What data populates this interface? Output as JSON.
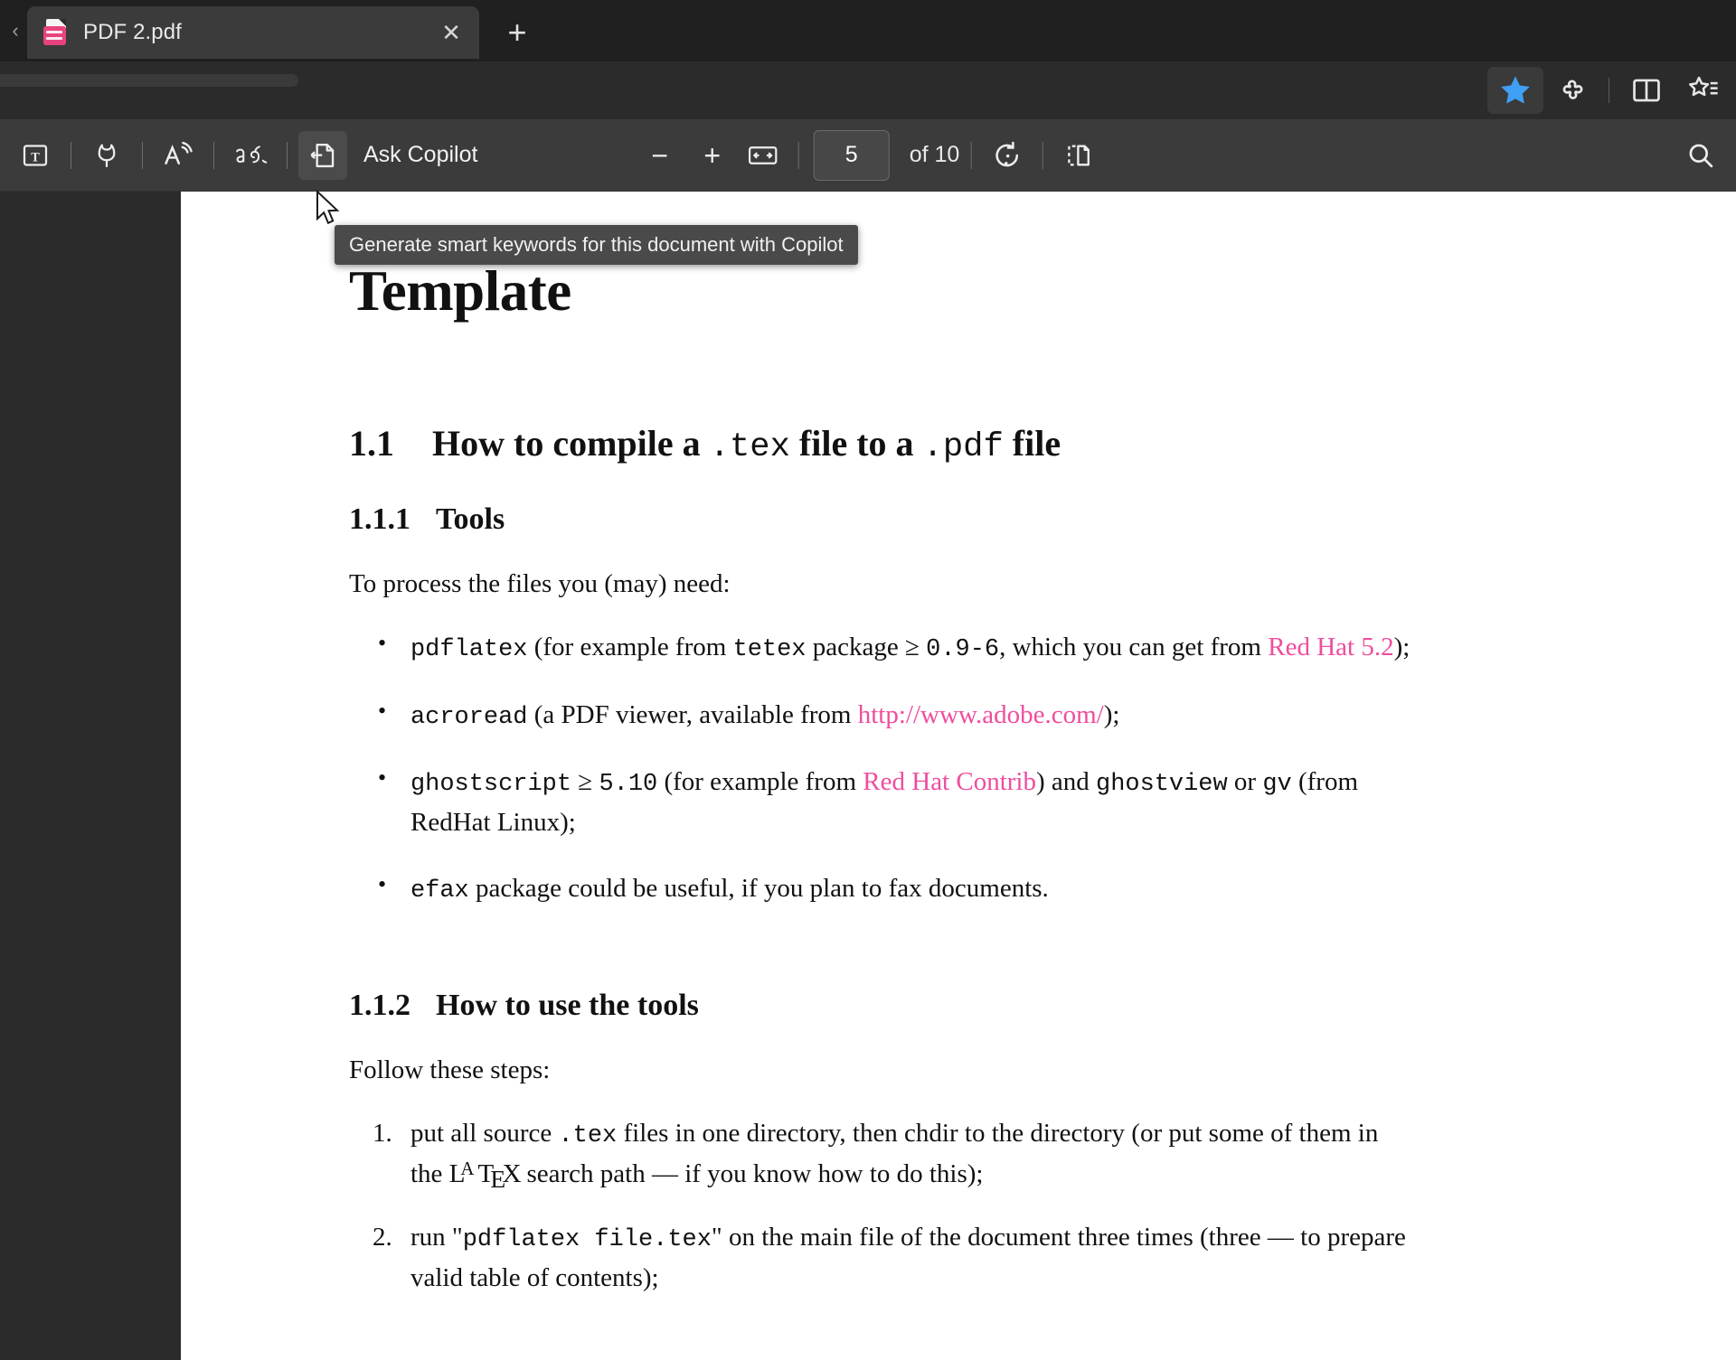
{
  "browser": {
    "tab": {
      "title": "PDF 2.pdf",
      "favicon": "pdf-file-icon",
      "close_label": "✕"
    },
    "new_tab_label": "+",
    "back_chevron": "‹",
    "actions": [
      {
        "name": "favorite-star-icon",
        "state": "filled",
        "color": "#3f9ff5"
      },
      {
        "name": "extensions-icon"
      },
      {
        "name": "split-screen-icon"
      },
      {
        "name": "collections-icon"
      }
    ]
  },
  "pdf_toolbar": {
    "tools": [
      {
        "name": "text-selection-icon",
        "label": "T"
      },
      {
        "name": "draw-ink-icon"
      },
      {
        "name": "read-aloud-icon"
      },
      {
        "name": "translate-icon"
      },
      {
        "name": "smart-keywords-icon",
        "active": true
      }
    ],
    "ask_copilot_label": "Ask Copilot",
    "zoom_out_label": "−",
    "zoom_in_label": "+",
    "fit_to_width_name": "fit-to-width-icon",
    "page_number": "5",
    "page_total_label": "of 10",
    "rotate_name": "rotate-page-icon",
    "page_layout_name": "page-view-icon",
    "search_name": "search-icon"
  },
  "tooltip": {
    "text": "Generate smart keywords for this document with Copilot"
  },
  "document": {
    "title": "Template",
    "section1": {
      "number": "1.1",
      "parts": [
        {
          "text": "How to compile a ",
          "style": "bold"
        },
        {
          "text": ".tex",
          "style": "mono"
        },
        {
          "text": " file to a ",
          "style": "bold"
        },
        {
          "text": ".pdf",
          "style": "mono"
        },
        {
          "text": " file",
          "style": "bold"
        }
      ]
    },
    "subsection_tools": {
      "number": "1.1.1",
      "title": "Tools"
    },
    "intro_tools": "To process the files you (may) need:",
    "bullets": [
      {
        "segments": [
          {
            "t": "pdflatex",
            "s": "mono"
          },
          {
            "t": " (for example from ",
            "s": "normal"
          },
          {
            "t": "tetex",
            "s": "mono"
          },
          {
            "t": " package ",
            "s": "normal"
          },
          {
            "t": "≥ ",
            "s": "normal"
          },
          {
            "t": "0.9-6",
            "s": "mono"
          },
          {
            "t": ", which you can get from ",
            "s": "normal"
          },
          {
            "t": "Red Hat 5.2",
            "s": "link"
          },
          {
            "t": ");",
            "s": "normal"
          }
        ]
      },
      {
        "segments": [
          {
            "t": "acroread",
            "s": "mono"
          },
          {
            "t": " (a PDF viewer, available from ",
            "s": "normal"
          },
          {
            "t": "http://www.adobe.com/",
            "s": "link"
          },
          {
            "t": ");",
            "s": "normal"
          }
        ]
      },
      {
        "segments": [
          {
            "t": "ghostscript",
            "s": "mono"
          },
          {
            "t": " ≥ ",
            "s": "normal"
          },
          {
            "t": "5.10",
            "s": "mono"
          },
          {
            "t": " (for example from ",
            "s": "normal"
          },
          {
            "t": "Red Hat Contrib",
            "s": "link"
          },
          {
            "t": ") and ",
            "s": "normal"
          },
          {
            "t": "ghostview",
            "s": "mono"
          },
          {
            "t": " or ",
            "s": "normal"
          },
          {
            "t": "gv",
            "s": "mono"
          },
          {
            "t": " (from RedHat Linux);",
            "s": "normal"
          }
        ]
      },
      {
        "segments": [
          {
            "t": "efax",
            "s": "mono"
          },
          {
            "t": " package could be useful, if you plan to fax documents.",
            "s": "normal"
          }
        ]
      }
    ],
    "subsection_howto": {
      "number": "1.1.2",
      "title": "How to use the tools"
    },
    "intro_howto": "Follow these steps:",
    "steps": [
      {
        "segments": [
          {
            "t": "put all source ",
            "s": "normal"
          },
          {
            "t": ".tex",
            "s": "mono"
          },
          {
            "t": " files in one directory, then chdir to the directory (or put some of them in the ",
            "s": "normal"
          },
          {
            "t": "LaTeX",
            "s": "latex"
          },
          {
            "t": "search path — if you know how to do this);",
            "s": "normal"
          }
        ]
      },
      {
        "segments": [
          {
            "t": "run \"",
            "s": "normal"
          },
          {
            "t": "pdflatex file.tex",
            "s": "mono"
          },
          {
            "t": "\" on the main file of the document three times (three — to prepare valid table of contents);",
            "s": "normal"
          }
        ]
      }
    ]
  }
}
